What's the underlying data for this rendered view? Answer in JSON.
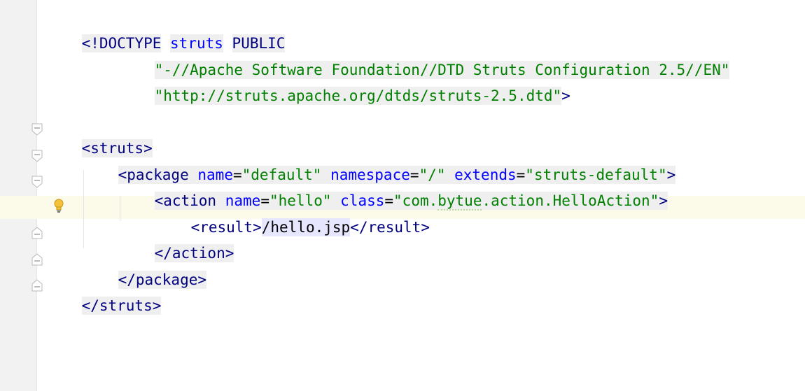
{
  "colors": {
    "gutter": "#f2f2f2",
    "caret_row": "#fcfae9",
    "tag": "#000080",
    "attribute": "#0000ff",
    "value": "#008000",
    "text_highlight": "#e6e6ff"
  },
  "code": {
    "doctype": {
      "open": "<!DOCTYPE",
      "root": "struts",
      "public": "PUBLIC",
      "fpi": "\"-//Apache Software Foundation//DTD Struts Configuration 2.5//EN\"",
      "dtd_url": "\"http://struts.apache.org/dtds/struts-2.5.dtd\"",
      "close": ">"
    },
    "struts_open": "<struts>",
    "package": {
      "open": "<package",
      "name_attr": "name",
      "name_val": "\"default\"",
      "ns_attr": "namespace",
      "ns_val": "\"/\"",
      "ext_attr": "extends",
      "ext_val": "\"struts-default\"",
      "close": ">"
    },
    "action": {
      "open": "<action",
      "name_attr": "name",
      "name_val": "\"hello\"",
      "class_attr": "class",
      "class_val_pre": "\"com.",
      "class_val_squiggle": "bytue",
      "class_val_post": ".action.HelloAction\"",
      "close": ">"
    },
    "result": {
      "open": "<result>",
      "text": "/hello.jsp",
      "close": "</result>"
    },
    "action_close": "</action>",
    "package_close": "</package>",
    "struts_close": "</struts>"
  },
  "icons": {
    "fold": "fold-marker-icon",
    "intention": "lightbulb-icon"
  }
}
